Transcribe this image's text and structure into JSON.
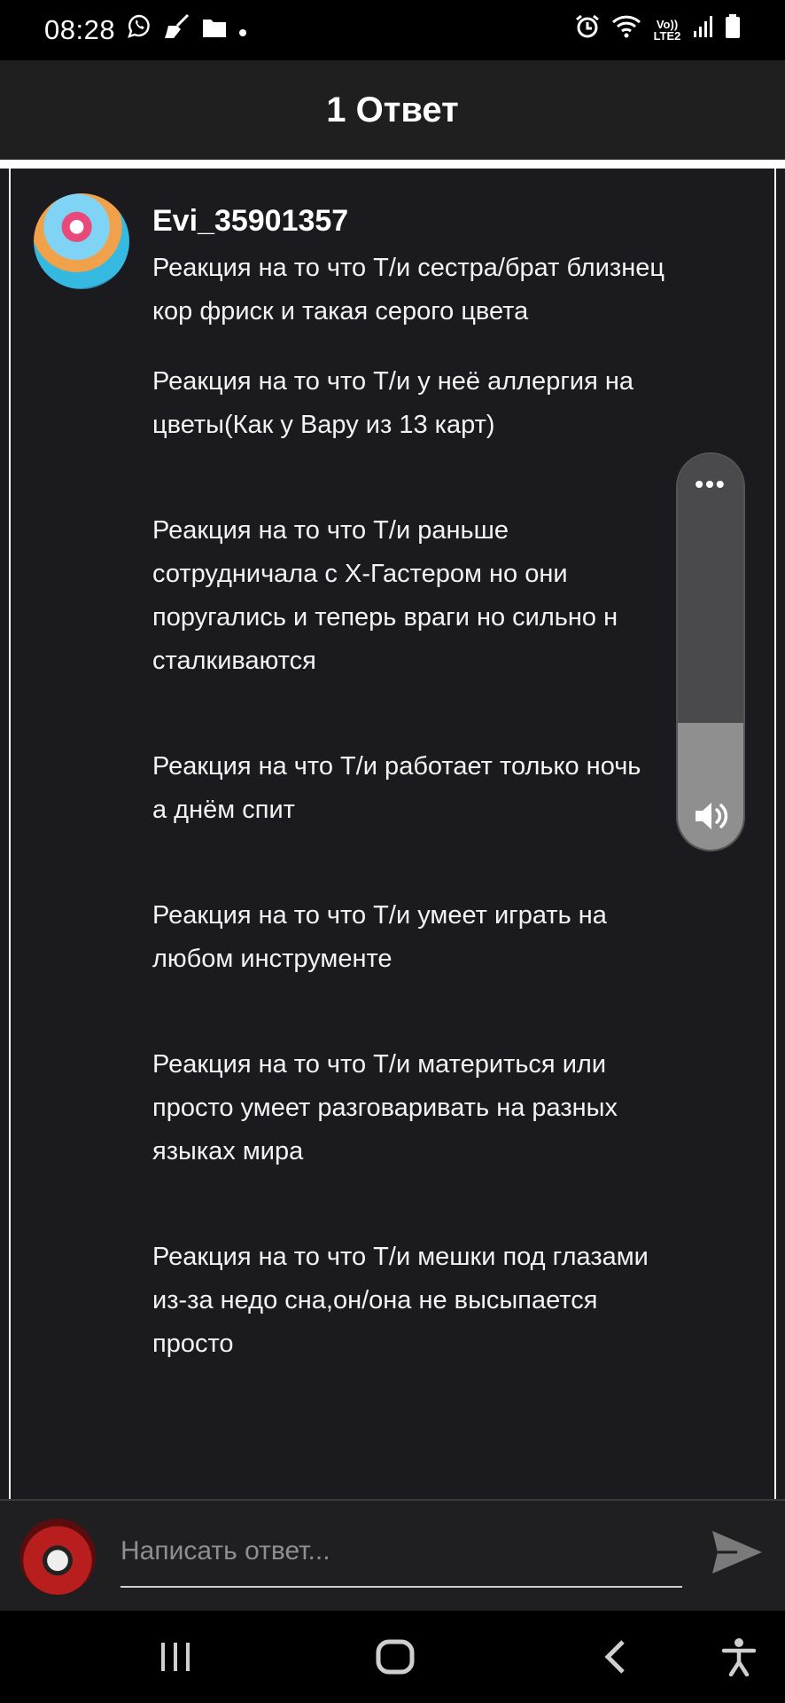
{
  "status_bar": {
    "time": "08:28",
    "left_icons": [
      "viber-icon",
      "broom-icon",
      "folder-icon",
      "dot-icon"
    ],
    "right_icons": [
      "alarm-icon",
      "wifi-icon",
      "volte-icon",
      "signal-icon",
      "battery-icon"
    ],
    "volte_label": "Vo)) LTE2"
  },
  "header": {
    "title": "1 Ответ"
  },
  "post": {
    "username": "Evi_35901357",
    "paragraphs": [
      "Реакция на то что Т/и сестра/брат близнец\nкор фриск и такая серого цвета",
      "Реакция на то что Т/и у неё аллергия на\nцветы(Как у Вару из 13 карт)",
      "Реакция на то что Т/и раньше\nсотрудничала с X-Гастером но они\nпоругались и теперь враги но сильно н\nсталкиваются",
      "Реакция на что Т/и работает только ночь\nа днём спит",
      "Реакция на то что Т/и умеет играть на\nлюбом инструменте",
      "Реакция на то что Т/и материться или\nпросто умеет разговаривать на разных\nязыках мира",
      "Реакция на то что Т/и мешки под глазами\nиз-за недо сна,он/она не высыпается\nпросто"
    ]
  },
  "volume_overlay": {
    "level_percent": 32,
    "more_label": "•••"
  },
  "reply": {
    "placeholder": "Написать ответ..."
  },
  "nav_bar": {
    "buttons": [
      "recents",
      "home",
      "back",
      "accessibility"
    ]
  }
}
